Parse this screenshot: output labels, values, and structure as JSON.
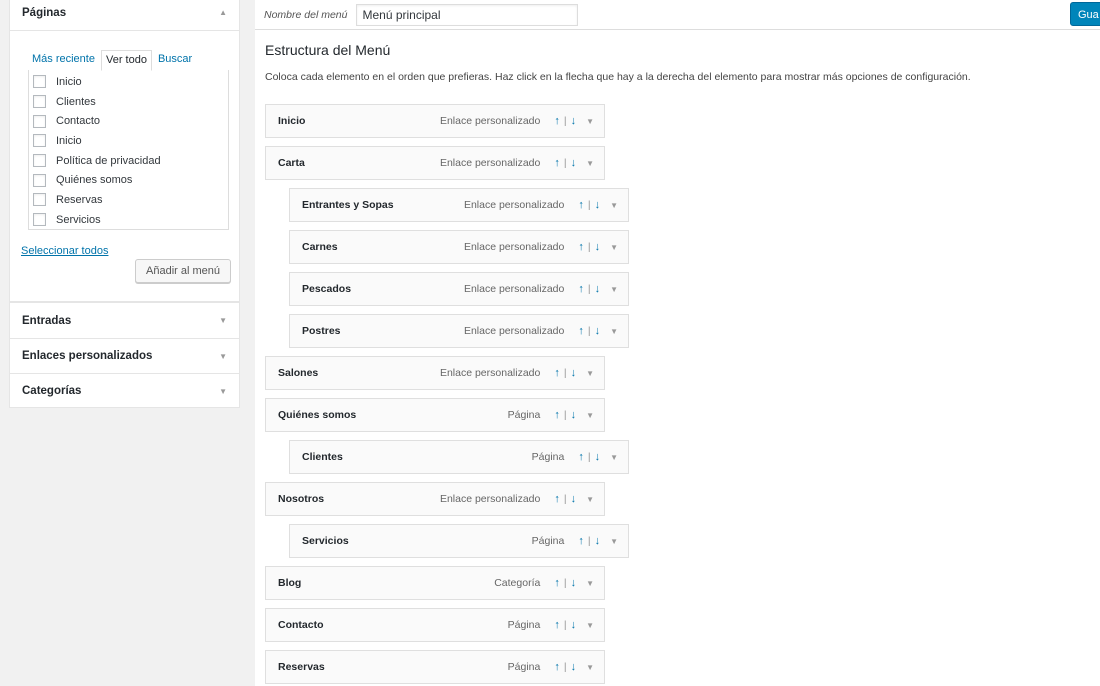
{
  "sidebar": {
    "pages_title": "Páginas",
    "tabs": [
      {
        "label": "Más reciente"
      },
      {
        "label": "Ver todo"
      },
      {
        "label": "Buscar"
      }
    ],
    "pages": [
      "Inicio",
      "Clientes",
      "Contacto",
      "Inicio",
      "Política de privacidad",
      "Quiénes somos",
      "Reservas",
      "Servicios"
    ],
    "select_all": "Seleccionar todos",
    "add_button": "Añadir al menú",
    "sections": [
      "Entradas",
      "Enlaces personalizados",
      "Categorías"
    ]
  },
  "header": {
    "menu_name_label": "Nombre del menú",
    "menu_name_value": "Menú principal",
    "save_button": "Gua"
  },
  "structure": {
    "title": "Estructura del Menú",
    "description": "Coloca cada elemento en el orden que prefieras. Haz click en la flecha que hay a la derecha del elemento para mostrar más opciones de configuración.",
    "up": "↑",
    "sep": "|",
    "down": "↓",
    "items": [
      {
        "title": "Inicio",
        "type": "Enlace personalizado",
        "depth": 0
      },
      {
        "title": "Carta",
        "type": "Enlace personalizado",
        "depth": 0
      },
      {
        "title": "Entrantes y Sopas",
        "type": "Enlace personalizado",
        "depth": 1
      },
      {
        "title": "Carnes",
        "type": "Enlace personalizado",
        "depth": 1
      },
      {
        "title": "Pescados",
        "type": "Enlace personalizado",
        "depth": 1
      },
      {
        "title": "Postres",
        "type": "Enlace personalizado",
        "depth": 1
      },
      {
        "title": "Salones",
        "type": "Enlace personalizado",
        "depth": 0
      },
      {
        "title": "Quiénes somos",
        "type": "Página",
        "depth": 0
      },
      {
        "title": "Clientes",
        "type": "Página",
        "depth": 1
      },
      {
        "title": "Nosotros",
        "type": "Enlace personalizado",
        "depth": 0
      },
      {
        "title": "Servicios",
        "type": "Página",
        "depth": 1
      },
      {
        "title": "Blog",
        "type": "Categoría",
        "depth": 0
      },
      {
        "title": "Contacto",
        "type": "Página",
        "depth": 0
      },
      {
        "title": "Reservas",
        "type": "Página",
        "depth": 0
      }
    ]
  }
}
